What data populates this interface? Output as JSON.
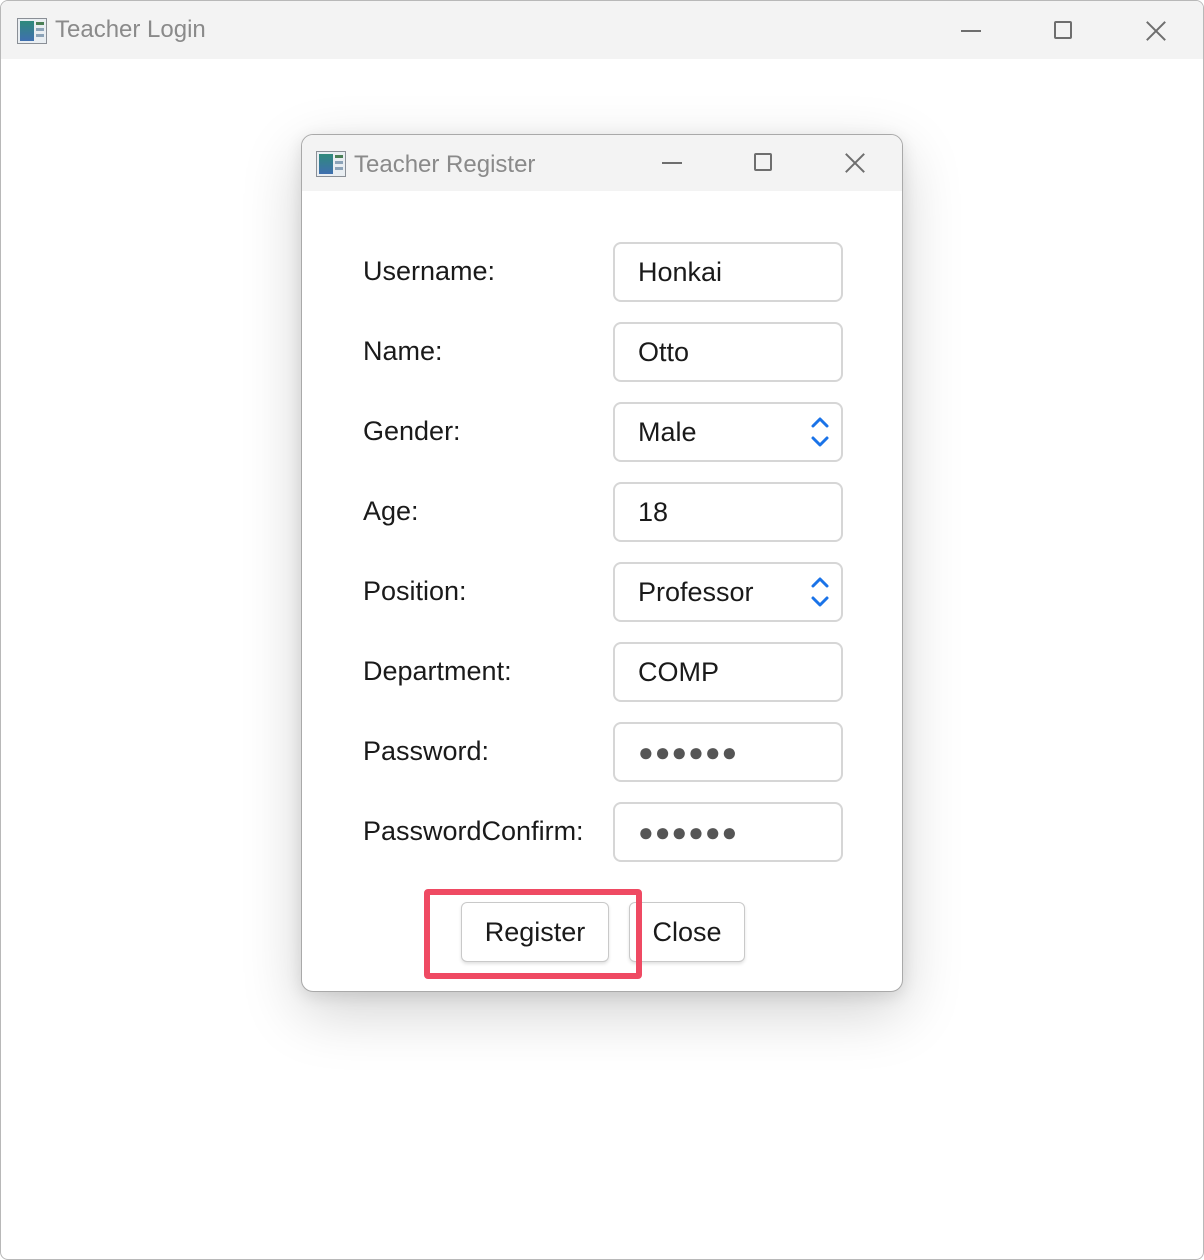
{
  "outer_window": {
    "title": "Teacher Login"
  },
  "dialog": {
    "title": "Teacher Register",
    "fields": [
      {
        "label": "Username:",
        "value": "Honkai",
        "type": "text"
      },
      {
        "label": "Name:",
        "value": "Otto",
        "type": "text"
      },
      {
        "label": "Gender:",
        "value": "Male",
        "type": "spinner"
      },
      {
        "label": "Age:",
        "value": "18",
        "type": "text"
      },
      {
        "label": "Position:",
        "value": "Professor",
        "type": "spinner"
      },
      {
        "label": "Department:",
        "value": "COMP",
        "type": "text"
      },
      {
        "label": "Password:",
        "value": "●●●●●●",
        "type": "password"
      },
      {
        "label": "PasswordConfirm:",
        "value": "●●●●●●",
        "type": "password"
      }
    ],
    "buttons": {
      "register_label": "Register",
      "close_label": "Close"
    }
  },
  "icons": {
    "minimize": "minimize-icon",
    "maximize": "maximize-icon",
    "close": "close-icon",
    "app": "app-icon",
    "spinner": "spinner-up-down-icon"
  },
  "colors": {
    "accent_spinner": "#1a73e8",
    "highlight": "#ef4a63",
    "titlebar_bg": "#f3f3f3"
  }
}
